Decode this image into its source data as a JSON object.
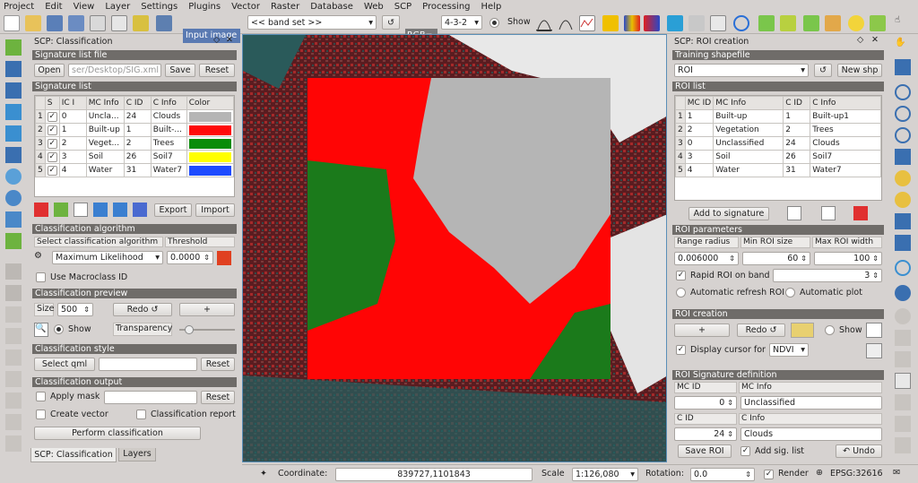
{
  "menu": [
    "Project",
    "Edit",
    "View",
    "Layer",
    "Settings",
    "Plugins",
    "Vector",
    "Raster",
    "Database",
    "Web",
    "SCP",
    "Processing",
    "Help"
  ],
  "toolbar": {
    "input_image": "Input image",
    "band_set": "<< band set >>",
    "rgb_label": "RGB=",
    "rgb_value": "4-3-2",
    "show_label": "Show"
  },
  "left": {
    "title": "SCP: Classification",
    "sig_file_hdr": "Signature list file",
    "open": "Open",
    "path": "ser/Desktop/SIG.xml",
    "save": "Save",
    "reset": "Reset",
    "sig_list_hdr": "Signature list",
    "sig_cols": [
      "S",
      "IC I",
      "MC Info",
      "C ID",
      "C Info",
      "Color"
    ],
    "sig_rows": [
      {
        "n": "1",
        "mc": "0",
        "mcinfo": "Uncla...",
        "cid": "24",
        "cinfo": "Clouds",
        "color": "#b5b5b5"
      },
      {
        "n": "2",
        "mc": "1",
        "mcinfo": "Built-up",
        "cid": "1",
        "cinfo": "Built-...",
        "color": "#ff0a0a"
      },
      {
        "n": "3",
        "mc": "2",
        "mcinfo": "Veget...",
        "cid": "2",
        "cinfo": "Trees",
        "color": "#0a8c0a"
      },
      {
        "n": "4",
        "mc": "3",
        "mcinfo": "Soil",
        "cid": "26",
        "cinfo": "Soil7",
        "color": "#ffff00"
      },
      {
        "n": "5",
        "mc": "4",
        "mcinfo": "Water",
        "cid": "31",
        "cinfo": "Water7",
        "color": "#1e4bff"
      }
    ],
    "export": "Export",
    "import": "Import",
    "alg_hdr": "Classification algorithm",
    "select_alg": "Select classification algorithm",
    "threshold": "Threshold",
    "alg_value": "Maximum Likelihood",
    "threshold_value": "0.0000",
    "macroclass": "Use Macroclass ID",
    "preview_hdr": "Classification preview",
    "size": "Size",
    "size_value": "500",
    "redo": "Redo ↺",
    "plus": "+",
    "show": "Show",
    "transparency": "Transparency",
    "style_hdr": "Classification style",
    "select_qml": "Select qml",
    "output_hdr": "Classification output",
    "apply_mask": "Apply mask",
    "create_vector": "Create vector",
    "class_report": "Classification report",
    "perform": "Perform classification",
    "tab1": "SCP: Classification",
    "tab2": "Layers"
  },
  "right": {
    "title": "SCP: ROI creation",
    "shp_hdr": "Training shapefile",
    "shp_value": "ROI",
    "new_shp": "New shp",
    "roi_list_hdr": "ROI list",
    "roi_cols": [
      "MC ID",
      "MC Info",
      "C ID",
      "C Info"
    ],
    "roi_rows": [
      {
        "n": "1",
        "mc": "1",
        "mcinfo": "Built-up",
        "cid": "1",
        "cinfo": "Built-up1"
      },
      {
        "n": "2",
        "mc": "2",
        "mcinfo": "Vegetation",
        "cid": "2",
        "cinfo": "Trees"
      },
      {
        "n": "3",
        "mc": "0",
        "mcinfo": "Unclassified",
        "cid": "24",
        "cinfo": "Clouds"
      },
      {
        "n": "4",
        "mc": "3",
        "mcinfo": "Soil",
        "cid": "26",
        "cinfo": "Soil7"
      },
      {
        "n": "5",
        "mc": "4",
        "mcinfo": "Water",
        "cid": "31",
        "cinfo": "Water7"
      }
    ],
    "add_sig": "Add to signature",
    "params_hdr": "ROI parameters",
    "range_radius": "Range radius",
    "min_roi": "Min ROI size",
    "max_roi": "Max ROI width",
    "range_value": "0.006000",
    "min_value": "60",
    "max_value": "100",
    "rapid": "Rapid ROI on band",
    "rapid_value": "3",
    "auto_refresh": "Automatic refresh ROI",
    "auto_plot": "Automatic  plot",
    "creation_hdr": "ROI creation",
    "plus": "+",
    "redo": "Redo ↺",
    "show": "Show",
    "display_cursor": "Display cursor for",
    "cursor_value": "NDVI",
    "sigdef_hdr": "ROI Signature definition",
    "mc_id": "MC ID",
    "mc_info": "MC Info",
    "mc_id_value": "0",
    "mc_info_value": "Unclassified",
    "c_id": "C ID",
    "c_info": "C Info",
    "c_id_value": "24",
    "c_info_value": "Clouds",
    "save_roi": "Save ROI",
    "add_sig_list": "Add sig. list",
    "undo": "↶ Undo"
  },
  "status": {
    "coordinate_label": "Coordinate:",
    "coordinate": "839727,1101843",
    "scale_label": "Scale",
    "scale": "1:126,080",
    "rotation_label": "Rotation:",
    "rotation": "0.0",
    "render": "Render",
    "epsg": "EPSG:32616"
  }
}
